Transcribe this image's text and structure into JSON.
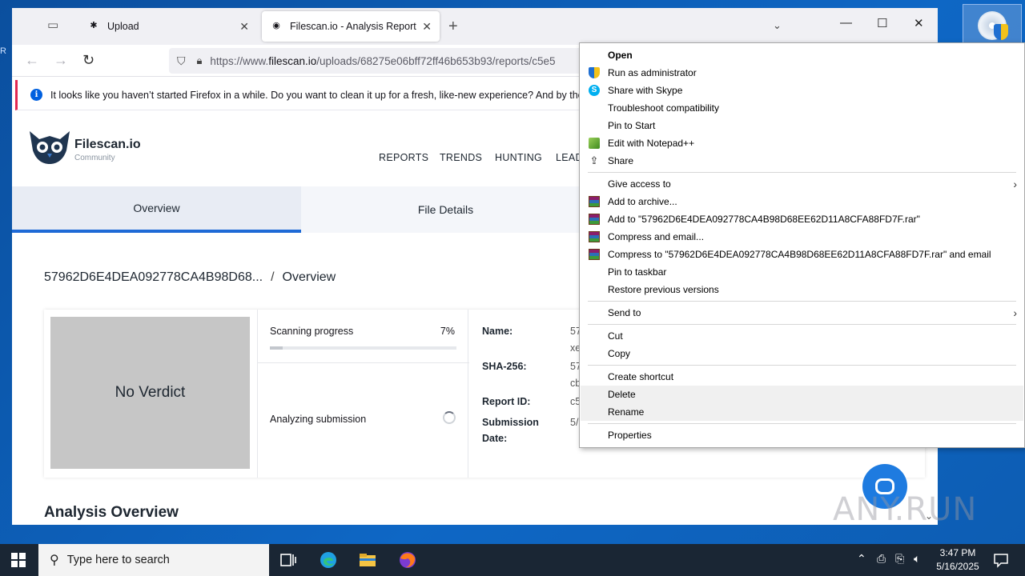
{
  "browser": {
    "tabs": [
      {
        "title": "Upload",
        "icon": "bug-icon"
      },
      {
        "title": "Filescan.io - Analysis Report for",
        "icon": "filescan-icon"
      }
    ],
    "url_prefix": "https://www.",
    "url_domain": "filescan.io",
    "url_path": "/uploads/68275e06bff72ff46b653b93/reports/c5e5",
    "notification": "It looks like you haven’t started Firefox in a while. Do you want to clean it up for a fresh, like-new experience? And by the way,"
  },
  "site": {
    "brand": "Filescan.io",
    "brand_sub": "Community",
    "nav": [
      "REPORTS",
      "TRENDS",
      "HUNTING",
      "LEAD"
    ],
    "tabs": [
      "Overview",
      "File Details"
    ],
    "breadcrumb_file": "57962D6E4DEA092778CA4B98D68...",
    "breadcrumb_sep": "/",
    "breadcrumb_page": "Overview",
    "verdict": "No Verdict",
    "progress_label": "Scanning progress",
    "progress_text": "7%",
    "progress_value": 0.07,
    "analyzing": "Analyzing submission",
    "meta": {
      "name_k": "Name:",
      "name_v1": "57",
      "name_v2": "xe",
      "sha_k": "SHA-256:",
      "sha_v1": "57",
      "sha_v2": "cb",
      "report_k": "Report ID:",
      "report_v": "c5",
      "sub_k1": "Submission",
      "sub_k2": "Date:",
      "sub_v": "5/"
    },
    "analysis_title": "Analysis Overview",
    "watermark": "ANY.RUN"
  },
  "context_menu": {
    "items": [
      {
        "label": "Open",
        "bold": true
      },
      {
        "label": "Run as administrator",
        "icon": "uac-shield-icon"
      },
      {
        "label": "Share with Skype",
        "icon": "skype-icon"
      },
      {
        "label": "Troubleshoot compatibility"
      },
      {
        "label": "Pin to Start"
      },
      {
        "label": "Edit with Notepad++",
        "icon": "notepadpp-icon"
      },
      {
        "label": "Share",
        "icon": "share-icon"
      },
      {
        "label": "Give access to",
        "submenu": true
      },
      {
        "label": "Add to archive...",
        "icon": "winrar-icon"
      },
      {
        "label": "Add to \"57962D6E4DEA092778CA4B98D68EE62D11A8CFA88FD7F.rar\"",
        "icon": "winrar-icon"
      },
      {
        "label": "Compress and email...",
        "icon": "winrar-icon"
      },
      {
        "label": "Compress to \"57962D6E4DEA092778CA4B98D68EE62D11A8CFA88FD7F.rar\" and email",
        "icon": "winrar-icon"
      },
      {
        "label": "Pin to taskbar"
      },
      {
        "label": "Restore previous versions"
      },
      {
        "label": "Send to",
        "submenu": true
      },
      {
        "label": "Cut"
      },
      {
        "label": "Copy"
      },
      {
        "label": "Create shortcut"
      },
      {
        "label": "Delete"
      },
      {
        "label": "Rename"
      },
      {
        "label": "Properties"
      }
    ]
  },
  "taskbar": {
    "search_placeholder": "Type here to search",
    "time": "3:47 PM",
    "date": "5/16/2025"
  },
  "colors": {
    "accent": "#1e6ad6",
    "taskbar": "#1a2634",
    "desktop": "#0e67c5"
  }
}
